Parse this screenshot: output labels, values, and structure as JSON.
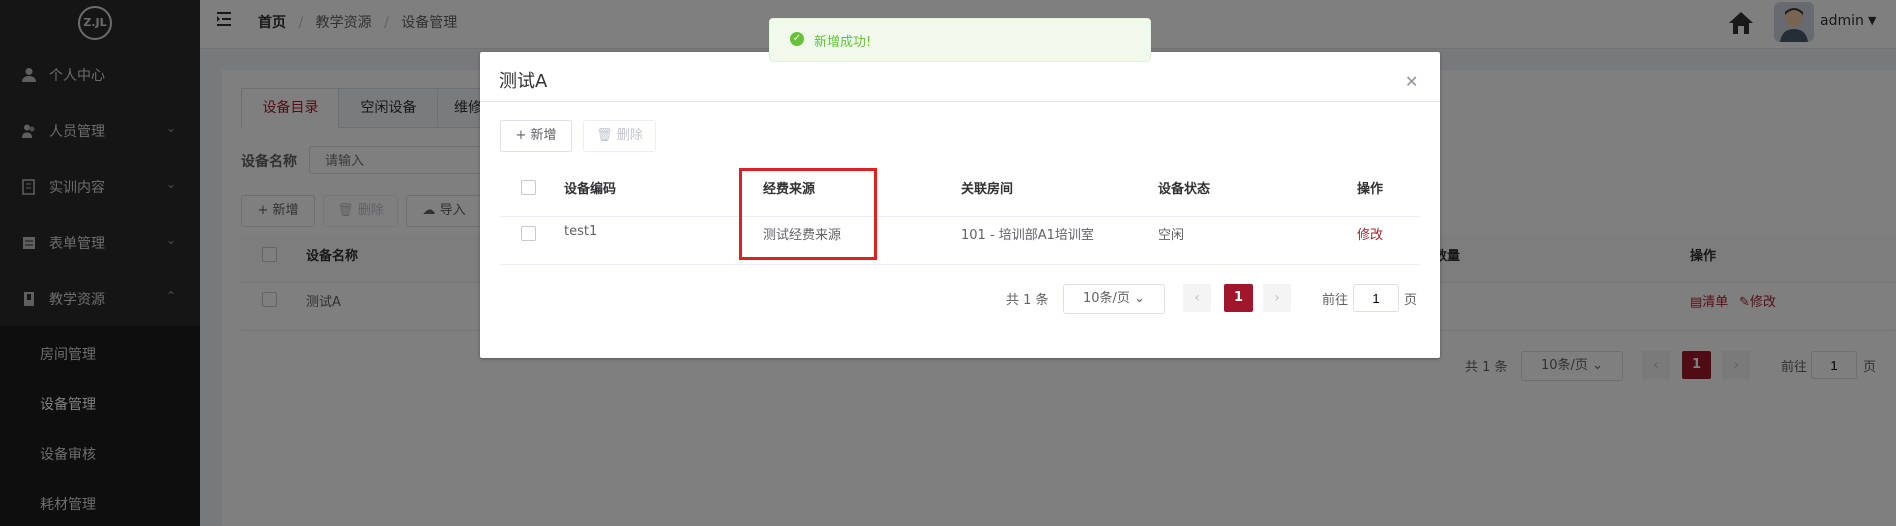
{
  "app": {
    "logo_text": "Z.JL",
    "user": "admin"
  },
  "colors": {
    "brand": "#a0162a",
    "sidebar": "#2b2b2b",
    "success": "#67c23a",
    "highlight": "#e02020"
  },
  "sidebar": {
    "items": [
      {
        "label": "个人中心",
        "icon": "user-icon"
      },
      {
        "label": "人员管理",
        "icon": "people-icon"
      },
      {
        "label": "实训内容",
        "icon": "book-icon"
      },
      {
        "label": "表单管理",
        "icon": "form-icon"
      },
      {
        "label": "教学资源",
        "icon": "resource-icon"
      }
    ],
    "sub_items": [
      "房间管理",
      "设备管理",
      "设备审核",
      "耗材管理"
    ]
  },
  "breadcrumb": [
    "首页",
    "教学资源",
    "设备管理"
  ],
  "page": {
    "tabs": [
      "设备目录",
      "空闲设备",
      "维修"
    ],
    "search_label": "设备名称",
    "search_placeholder": "请输入",
    "buttons": {
      "add": "新增",
      "delete": "删除",
      "import": "导入"
    },
    "table_headers": [
      "设备名称",
      "数量",
      "操作"
    ],
    "rows": [
      {
        "name": "测试A",
        "action_clear": "清单",
        "action_edit": "修改"
      }
    ],
    "pager": {
      "total": "共 1 条",
      "page_size": "10条/页",
      "current": "1",
      "goto_label": "前往",
      "goto_value": "1",
      "page_unit": "页"
    }
  },
  "toast": {
    "message": "新增成功!"
  },
  "dialog": {
    "title": "测试A",
    "buttons": {
      "add": "新增",
      "delete": "删除"
    },
    "headers": [
      "设备编码",
      "经费来源",
      "关联房间",
      "设备状态",
      "操作"
    ],
    "rows": [
      {
        "code": "test1",
        "fund": "测试经费来源",
        "room": "101 - 培训部A1培训室",
        "status": "空闲",
        "action": "修改"
      }
    ],
    "pager": {
      "total": "共 1 条",
      "page_size": "10条/页",
      "current": "1",
      "goto_label": "前往",
      "goto_value": "1",
      "page_unit": "页"
    }
  }
}
